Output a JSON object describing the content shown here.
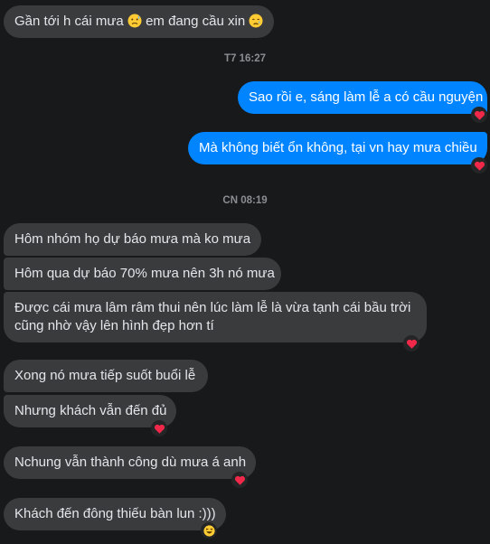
{
  "messages": [
    {
      "text_before": "Gần tới h cái mưa ",
      "text_mid": " em đang cầu xin ",
      "emoji_1": "sweat-face-icon",
      "emoji_2": "crying-face-icon",
      "side": "in"
    },
    {
      "text": "Sao rồi e, sáng làm lễ a có cầu nguyện",
      "side": "out",
      "reaction": "heart-icon"
    },
    {
      "text": "Mà không biết ổn không, tại vn hay mưa chiều",
      "side": "out",
      "reaction": "heart-icon"
    },
    {
      "text": "Hôm nhóm họ dự báo mưa mà ko mưa",
      "side": "in"
    },
    {
      "text": "Hôm qua dự báo 70% mưa nên 3h nó mưa",
      "side": "in"
    },
    {
      "text": "Được cái mưa lâm râm thui nên lúc làm lễ là vừa tạnh cái bầu trời cũng nhờ vậy lên hình đẹp hơn tí",
      "side": "in",
      "reaction": "heart-icon"
    },
    {
      "text": "Xong nó mưa tiếp suốt buổi lễ",
      "side": "in"
    },
    {
      "text": "Nhưng khách vẫn đến đủ",
      "side": "in",
      "reaction": "heart-icon"
    },
    {
      "text": "Nchung vẫn thành công dù mưa á anh",
      "side": "in",
      "reaction": "heart-icon"
    },
    {
      "text": "Khách đến đông thiếu bàn lun :)))",
      "side": "in",
      "reaction": "laughing-face-icon"
    }
  ],
  "timestamps": {
    "t1": "T7 16:27",
    "t2": "CN 08:19"
  },
  "colors": {
    "background": "#18191a",
    "incoming": "#3a3b3c",
    "outgoing": "#0084ff",
    "heart": "#f02849"
  }
}
